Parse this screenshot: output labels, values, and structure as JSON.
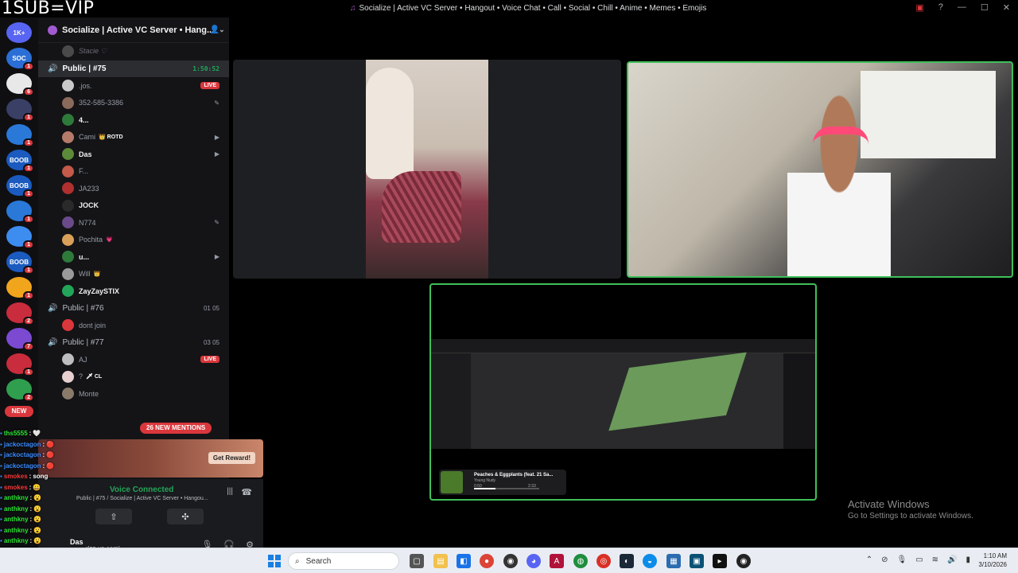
{
  "overlay": {
    "brand": "1SUB=VIP"
  },
  "window": {
    "title": "Socialize | Active VC Server • Hangout • Voice Chat • Call • Social • Chill • Anime • Memes • Emojis"
  },
  "rail": {
    "servers": [
      {
        "label": "1K+",
        "color": "#5865f2",
        "badge": ""
      },
      {
        "label": "SOC",
        "color": "#2b6fd6",
        "badge": "1"
      },
      {
        "label": "",
        "color": "#e8e8e8",
        "badge": "6"
      },
      {
        "label": "",
        "color": "#3a3f66",
        "badge": "1"
      },
      {
        "label": "",
        "color": "#2a78d8",
        "badge": "1"
      },
      {
        "label": "BOOB",
        "color": "#1b5bbf",
        "badge": "1"
      },
      {
        "label": "BOOB",
        "color": "#1b5bbf",
        "badge": "1"
      },
      {
        "label": "",
        "color": "#2a78d8",
        "badge": "1"
      },
      {
        "label": "",
        "color": "#3d8cf0",
        "badge": "1"
      },
      {
        "label": "BOOB",
        "color": "#1b5bbf",
        "badge": "1"
      },
      {
        "label": "",
        "color": "#f0a51d",
        "badge": "1"
      },
      {
        "label": "",
        "color": "#c92c3c",
        "badge": "2"
      },
      {
        "label": "",
        "color": "#7b4ad1",
        "badge": "7"
      },
      {
        "label": "",
        "color": "#c92c3c",
        "badge": "1"
      },
      {
        "label": "",
        "color": "#2f9e4e",
        "badge": "2"
      }
    ],
    "new_label": "NEW"
  },
  "server": {
    "name": "Socialize | Active VC Server • Hang..."
  },
  "channels": [
    {
      "type": "user",
      "name": "Stacie ♡",
      "avatar": "#4a4a4a",
      "faded": true
    },
    {
      "type": "vc",
      "name": "Public | #75",
      "active": true,
      "time": "1:50:52"
    },
    {
      "type": "user",
      "name": ".jos.",
      "avatar": "#c9c9c9",
      "live": "LIVE"
    },
    {
      "type": "user",
      "name": "352-585-3386",
      "avatar": "#8a6a5a",
      "right": "✎"
    },
    {
      "type": "user",
      "name": "4...",
      "avatar": "#2e7a3a",
      "bright": true
    },
    {
      "type": "user",
      "name": "Cami",
      "avatar": "#b57a6a",
      "tag": "👑 ROTD",
      "right": "▶"
    },
    {
      "type": "user",
      "name": "Das",
      "avatar": "#5c8a3a",
      "bright": true,
      "right": "▶"
    },
    {
      "type": "user",
      "name": "F...",
      "avatar": "#c45a4a"
    },
    {
      "type": "user",
      "name": "JA233",
      "avatar": "#b03030"
    },
    {
      "type": "user",
      "name": "JOCK",
      "avatar": "#2a2a2a",
      "bright": true
    },
    {
      "type": "user",
      "name": "N774",
      "avatar": "#6a4a8a",
      "right": "✎"
    },
    {
      "type": "user",
      "name": "Pochita",
      "avatar": "#d9a05a",
      "tag": "💗"
    },
    {
      "type": "user",
      "name": "u...",
      "avatar": "#2e7a3a",
      "bright": true,
      "right": "▶"
    },
    {
      "type": "user",
      "name": "Will",
      "avatar": "#9a9a9a",
      "tag": "👑"
    },
    {
      "type": "user",
      "name": "ZayZaySTIX",
      "avatar": "#23a559",
      "bright": true
    },
    {
      "type": "vc",
      "name": "Public | #76",
      "count": "01  05"
    },
    {
      "type": "user",
      "name": "dont join",
      "avatar": "#da373c"
    },
    {
      "type": "vc",
      "name": "Public | #77",
      "count": "03  05"
    },
    {
      "type": "user",
      "name": "AJ",
      "avatar": "#bdbdbd",
      "live": "LIVE"
    },
    {
      "type": "user",
      "name": "? ",
      "avatar": "#e8d0d0",
      "tag": "🗡 CL"
    },
    {
      "type": "user",
      "name": "Monte",
      "avatar": "#8a7a6a"
    }
  ],
  "mentions": "26 NEW MENTIONS",
  "promo": {
    "button": "Get Reward!"
  },
  "voice_panel": {
    "status": "Voice Connected",
    "channel": "Public | #75 / Socialize | Active VC Server • Hangou...",
    "user": "Das",
    "user_status": "rizz up cami"
  },
  "chat_overlay": [
    {
      "user": "ths5555",
      "msg": "🤍",
      "color": "green"
    },
    {
      "user": "jackoctagon",
      "msg": "🔴",
      "color": "blue"
    },
    {
      "user": "jackoctagon",
      "msg": "🔴",
      "color": "blue"
    },
    {
      "user": "jackoctagon",
      "msg": "🔴",
      "color": "blue"
    },
    {
      "user": "smokes",
      "msg": "song",
      "color": "red"
    },
    {
      "user": "smokes",
      "msg": "😀",
      "color": "red"
    },
    {
      "user": "anthkny",
      "msg": "😮",
      "color": "green"
    },
    {
      "user": "anthkny",
      "msg": "😮",
      "color": "green"
    },
    {
      "user": "anthkny",
      "msg": "😮",
      "color": "green"
    },
    {
      "user": "anthkny",
      "msg": "😮",
      "color": "green"
    },
    {
      "user": "anthkny",
      "msg": "😮",
      "color": "green"
    }
  ],
  "music": {
    "title": "Peaches & Eggplants (feat. 21 Sa...",
    "artist": "Young Nudy",
    "elapsed": "0:50",
    "duration": "2:33",
    "progress": 0.33
  },
  "watermark": {
    "title": "Activate Windows",
    "subtitle": "Go to Settings to activate Windows."
  },
  "taskbar": {
    "search_placeholder": "Search",
    "time": "1:10 AM",
    "date": "3/10/2026"
  }
}
